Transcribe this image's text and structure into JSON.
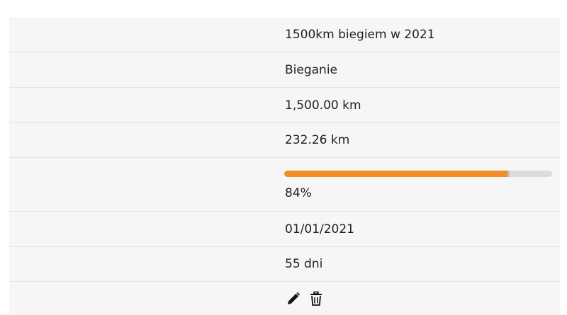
{
  "goal": {
    "name": "1500km biegiem w 2021",
    "activity": "Bieganie",
    "target_distance": "1,500.00 km",
    "current_distance": "232.26 km",
    "progress_percent_label": "84%",
    "progress_fraction": 0.84,
    "start_date": "01/01/2021",
    "days_left": "55 dni"
  },
  "actions": {
    "edit_icon": "pencil-icon",
    "delete_icon": "trash-icon"
  },
  "colors": {
    "progress_fill": "#f28c28",
    "progress_track": "#dcdcdc",
    "row_background": "#f6f6f6"
  }
}
